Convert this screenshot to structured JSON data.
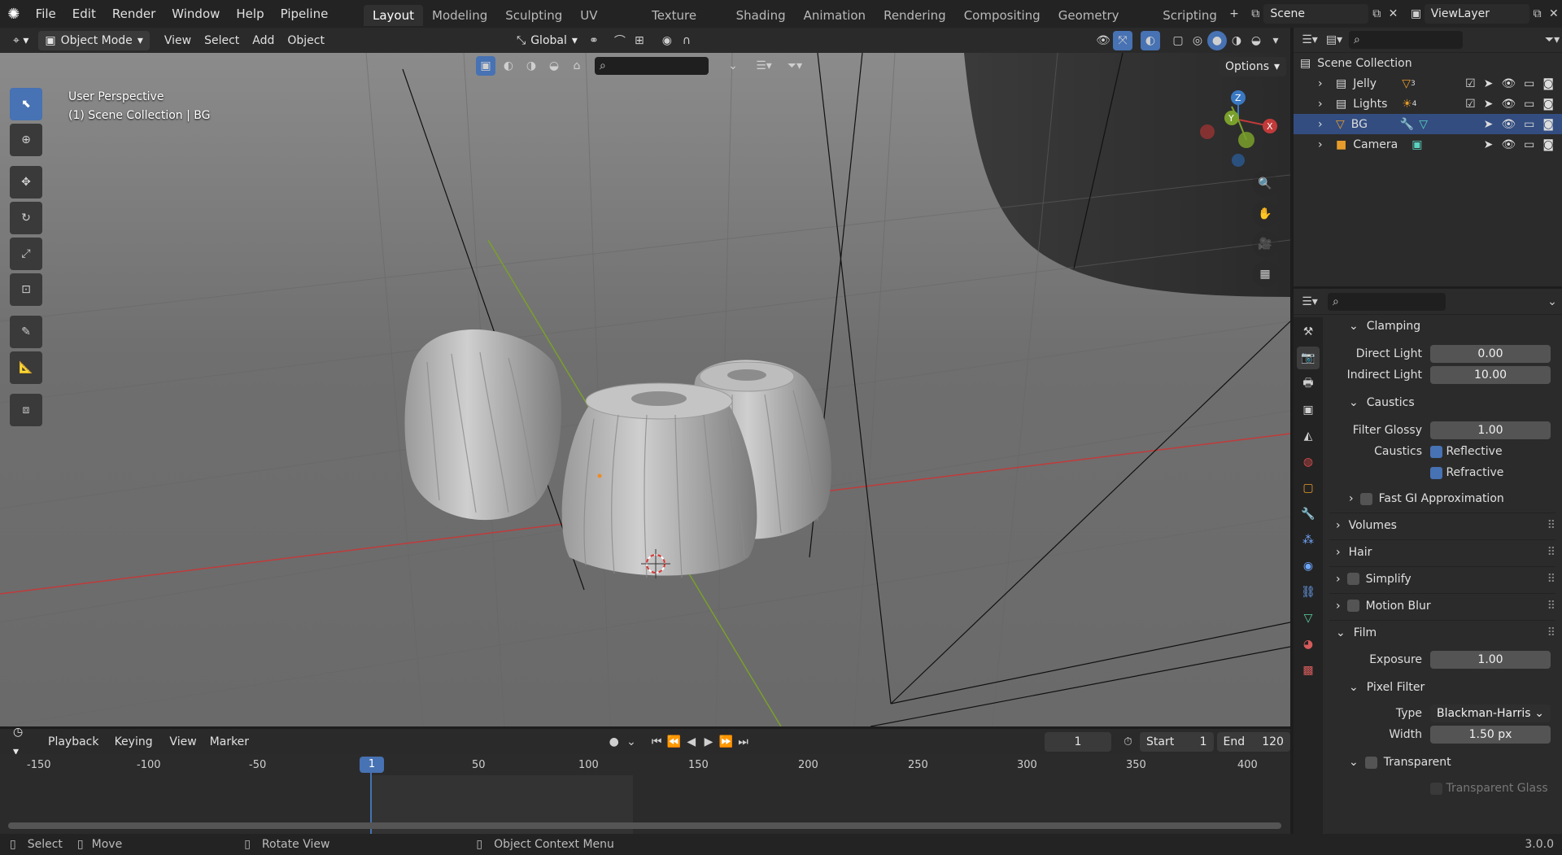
{
  "topbar": {
    "menus": [
      "File",
      "Edit",
      "Render",
      "Window",
      "Help",
      "Pipeline"
    ],
    "workspaces": [
      "Layout",
      "Modeling",
      "Sculpting",
      "UV Editing",
      "Texture Paint",
      "Shading",
      "Animation",
      "Rendering",
      "Compositing",
      "Geometry Nodes",
      "Scripting"
    ],
    "active_workspace": "Layout",
    "scene": "Scene",
    "view_layer": "ViewLayer"
  },
  "viewport_header": {
    "mode": "Object Mode",
    "menus": [
      "View",
      "Select",
      "Add",
      "Object"
    ],
    "orientation": "Global",
    "options": "Options"
  },
  "viewport": {
    "title": "User Perspective",
    "subtitle": "(1) Scene Collection | BG",
    "gizmo": {
      "x": "X",
      "y": "Y",
      "z": "Z"
    }
  },
  "outliner": {
    "root": "Scene Collection",
    "items": [
      {
        "label": "Jelly",
        "badge": "3"
      },
      {
        "label": "Lights",
        "badge": "4"
      },
      {
        "label": "BG",
        "badge": ""
      },
      {
        "label": "Camera",
        "badge": ""
      }
    ],
    "selected": "BG"
  },
  "properties": {
    "clamping": {
      "title": "Clamping",
      "direct_label": "Direct Light",
      "direct": "0.00",
      "indirect_label": "Indirect Light",
      "indirect": "10.00"
    },
    "caustics": {
      "title": "Caustics",
      "filter_label": "Filter Glossy",
      "filter": "1.00",
      "caustics_label": "Caustics",
      "reflective": "Reflective",
      "refractive": "Refractive"
    },
    "fast_gi": "Fast GI Approximation",
    "volumes": "Volumes",
    "hair": "Hair",
    "simplify": "Simplify",
    "motion_blur": "Motion Blur",
    "film": {
      "title": "Film",
      "exposure_label": "Exposure",
      "exposure": "1.00"
    },
    "pixel_filter": {
      "title": "Pixel Filter",
      "type_label": "Type",
      "type": "Blackman-Harris",
      "width_label": "Width",
      "width": "1.50 px"
    },
    "transparent": {
      "title": "Transparent",
      "glass": "Transparent Glass"
    }
  },
  "timeline": {
    "menus": [
      "Playback",
      "Keying",
      "View",
      "Marker"
    ],
    "current_frame": "1",
    "start_label": "Start",
    "start": "1",
    "end_label": "End",
    "end": "120",
    "ticks": [
      "-150",
      "-100",
      "-50",
      "1",
      "50",
      "100",
      "150",
      "200",
      "250",
      "300",
      "350",
      "400"
    ]
  },
  "statusbar": {
    "select": "Select",
    "move": "Move",
    "rotate": "Rotate View",
    "context": "Object Context Menu",
    "version": "3.0.0"
  },
  "colors": {
    "accent": "#4772b3",
    "selected_row": "#334d80",
    "x_axis": "#c23a3a",
    "y_axis": "#7aa02c",
    "z_axis": "#3a78c2"
  }
}
